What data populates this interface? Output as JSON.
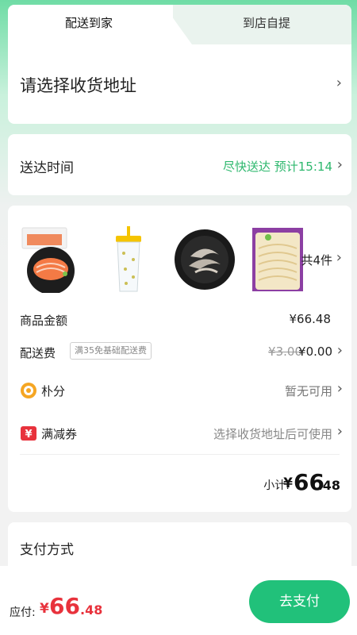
{
  "tabs": {
    "delivery": "配送到家",
    "pickup": "到店自提"
  },
  "address": {
    "placeholder": "请选择收货地址"
  },
  "delivery_time": {
    "label": "送达时间",
    "value": "尽快送达 预计15:14"
  },
  "goods": {
    "images": [
      "salmon-sashimi-icon",
      "drink-cup-icon",
      "shrimp-plate-icon",
      "noodles-pack-icon"
    ],
    "count_text": "共4件",
    "amount_label": "商品金额",
    "amount_value": "¥66.48",
    "fee_label": "配送费",
    "fee_tag": "满35免基础配送费",
    "fee_original": "¥3.00",
    "fee_value": "¥0.00",
    "points_label": "朴分",
    "points_value": "暂无可用",
    "coupon_label": "满减券",
    "coupon_value": "选择收货地址后可使用",
    "subtotal_label": "小计:",
    "subtotal_currency": "¥",
    "subtotal_int": "66",
    "subtotal_dec": ".48"
  },
  "payment": {
    "label": "支付方式"
  },
  "footer": {
    "due_label": "应付:",
    "due_currency": "¥",
    "due_int": "66",
    "due_dec": ".48",
    "pay_button": "去支付"
  },
  "colors": {
    "accent_green": "#21c17a",
    "time_green": "#2eb86e",
    "price_red": "#e8323c",
    "points_orange": "#f5a623",
    "coupon_red": "#e8323c"
  }
}
